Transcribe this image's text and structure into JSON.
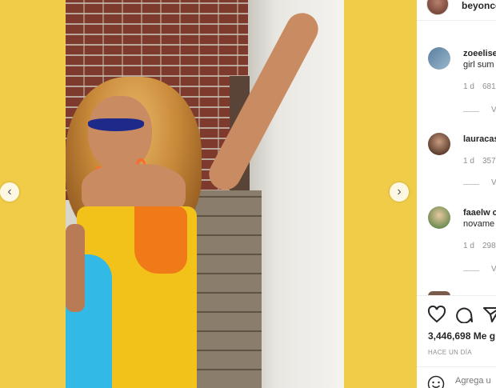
{
  "post": {
    "username": "beyonce",
    "image_alt": "Photo post"
  },
  "comments": [
    {
      "username": "zoeelise",
      "text": "girl sum",
      "time": "1 d",
      "likes": "681",
      "view_replies": "V"
    },
    {
      "username": "lauracas",
      "text": "",
      "time": "1 d",
      "likes": "357",
      "view_replies": "V"
    },
    {
      "username": "faaelw c",
      "text": "novame",
      "time": "1 d",
      "likes": "298",
      "view_replies": "V"
    }
  ],
  "actions": {
    "like_icon": "heart-icon",
    "comment_icon": "comment-icon",
    "share_icon": "share-icon"
  },
  "likes_text": "3,446,698 Me g",
  "date_text": "HACE UN DÍA",
  "add_comment_placeholder": "Agrega u",
  "nav": {
    "prev_icon": "chevron-left-icon",
    "next_icon": "chevron-right-icon"
  },
  "colors": {
    "background": "#f1cc48",
    "panel": "#ffffff",
    "text": "#262626",
    "muted": "#8e8e8e"
  }
}
